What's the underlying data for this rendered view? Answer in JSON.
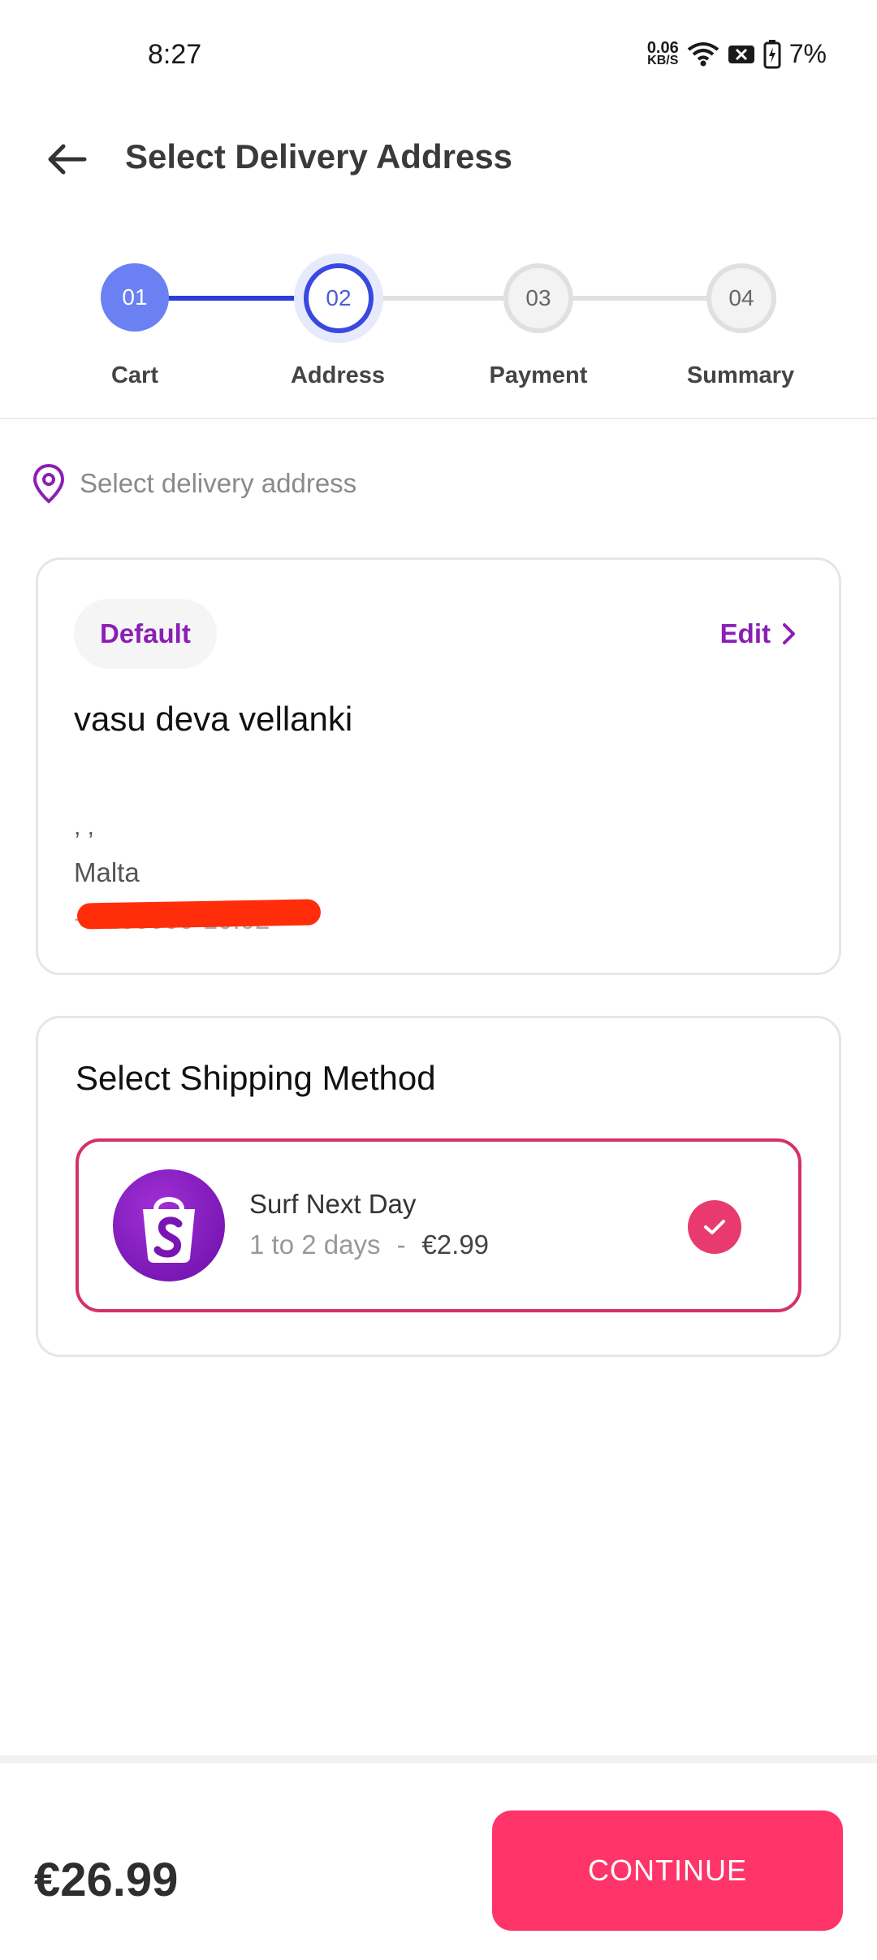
{
  "status_bar": {
    "time": "8:27",
    "net_speed_value": "0.06",
    "net_speed_unit": "KB/S",
    "battery": "7%"
  },
  "header": {
    "title": "Select Delivery Address"
  },
  "stepper": {
    "steps": [
      {
        "number": "01",
        "label": "Cart",
        "state": "done"
      },
      {
        "number": "02",
        "label": "Address",
        "state": "active"
      },
      {
        "number": "03",
        "label": "Payment",
        "state": "pending"
      },
      {
        "number": "04",
        "label": "Summary",
        "state": "pending"
      }
    ]
  },
  "address_section": {
    "prompt": "Select delivery address",
    "card": {
      "badge": "Default",
      "edit_label": "Edit",
      "name": "vasu deva vellanki",
      "line1": ", ,",
      "country": "Malta",
      "phone": "+3160000-10.02"
    }
  },
  "shipping": {
    "title": "Select Shipping Method",
    "option": {
      "name": "Surf Next Day",
      "duration": "1 to 2 days",
      "separator": "-",
      "price": "€2.99",
      "selected": true
    }
  },
  "footer": {
    "total": "€26.99",
    "continue_label": "CONTINUE"
  },
  "colors": {
    "accent_purple": "#8a1fb5",
    "stepper_blue": "#3949e0",
    "continue_pink": "#ff3469",
    "check_pink": "#e93a6f"
  }
}
